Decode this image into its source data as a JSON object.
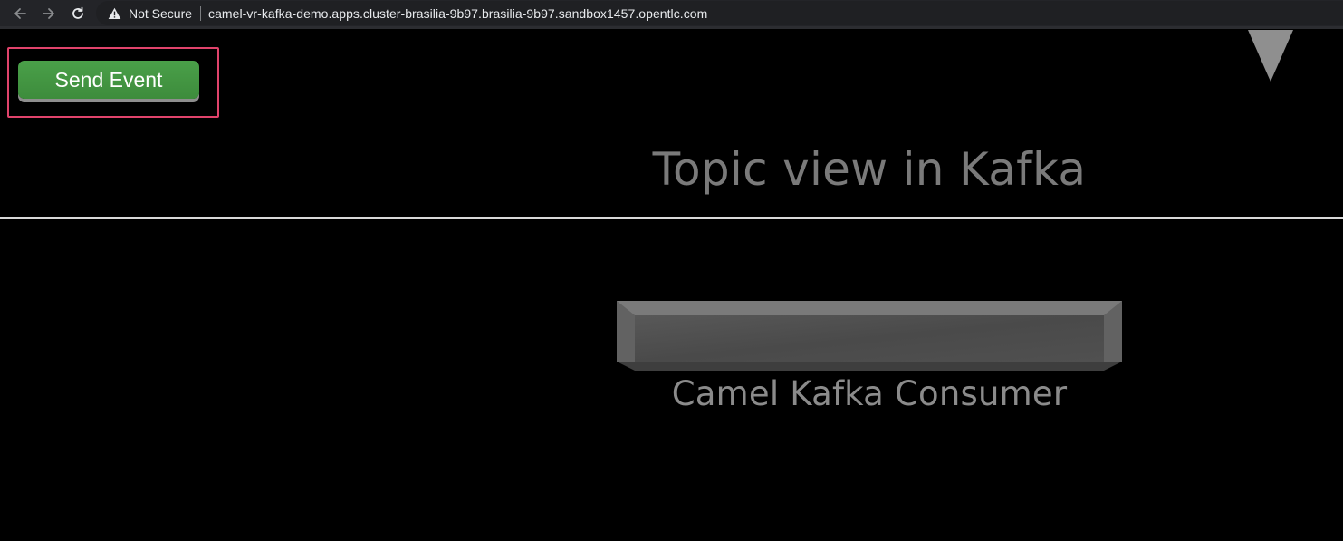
{
  "browser": {
    "security_label": "Not Secure",
    "url": "camel-vr-kafka-demo.apps.cluster-brasilia-9b97.brasilia-9b97.sandbox1457.opentlc.com",
    "icons": {
      "back": "back-arrow-icon",
      "forward": "forward-arrow-icon",
      "reload": "reload-icon",
      "warning": "warning-triangle-icon"
    }
  },
  "page": {
    "send_button_label": "Send Event",
    "topic_title": "Topic view in Kafka",
    "consumer_label": "Camel Kafka Consumer"
  },
  "colors": {
    "background": "#000000",
    "button_green": "#43963f",
    "highlight": "#e0436b",
    "text_gray": "#7a7a7a"
  }
}
